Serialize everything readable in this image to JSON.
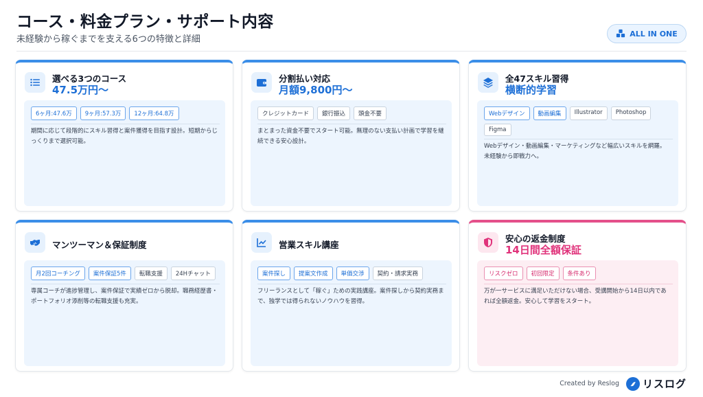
{
  "header": {
    "title": "コース・料金プラン・サポート内容",
    "subtitle": "未経験から稼ぐまでを支える6つの特徴と詳細",
    "badge_label": "ALL IN ONE"
  },
  "cards": [
    {
      "title": "選べる3つのコース",
      "highlight": "47.5万円〜",
      "icon": "list-icon",
      "tags": [
        "6ヶ月:47.6万",
        "9ヶ月:57.3万",
        "12ヶ月:64.8万"
      ],
      "description": "期間に応じて段階的にスキル習得と案件獲得を目指す設計。短期からじっくりまで選択可能。"
    },
    {
      "title": "分割払い対応",
      "highlight": "月額9,800円〜",
      "icon": "wallet-icon",
      "tags": [
        "クレジットカード",
        "銀行振込",
        "頭金不要"
      ],
      "description": "まとまった資金不要でスタート可能。無理のない支払い計画で学習を継続できる安心設計。"
    },
    {
      "title": "全47スキル習得",
      "highlight": "横断的学習",
      "icon": "layers-icon",
      "tags": [
        "Webデザイン",
        "動画編集",
        "Illustrator",
        "Photoshop",
        "Figma"
      ],
      "description": "Webデザイン・動画編集・マーケティングなど幅広いスキルを網羅。未経験から即戦力へ。"
    },
    {
      "title": "マンツーマン＆保証制度",
      "highlight": "",
      "icon": "handshake-icon",
      "tags": [
        "月2回コーチング",
        "案件保証5件",
        "転職支援",
        "24Hチャット"
      ],
      "description": "専属コーチが進捗管理し、案件保証で実績ゼロから脱却。職務経歴書・ポートフォリオ添削等の転職支援も充実。"
    },
    {
      "title": "営業スキル講座",
      "highlight": "",
      "icon": "chart-line-icon",
      "tags": [
        "案件探し",
        "提案文作成",
        "単価交渉",
        "契約・請求実務"
      ],
      "description": "フリーランスとして「稼ぐ」ための実践講座。案件探しから契約実務まで、独学では得られないノウハウを習得。"
    },
    {
      "title": "安心の返金制度",
      "highlight": "14日間全額保証",
      "icon": "shield-icon",
      "tags": [
        "リスクゼロ",
        "初回限定",
        "条件あり"
      ],
      "description": "万が一サービスに満足いただけない場合、受講開始から14日以内であれば全額返金。安心して学習をスタート。"
    }
  ],
  "footer": {
    "credit": "Created by Reslog",
    "logo_text": "リスログ"
  },
  "colors": {
    "accent": "#1d6fd6",
    "accent_bar": "#3b8ee8",
    "pink_accent": "#e0337b",
    "card_inner": "#edf5fe"
  }
}
